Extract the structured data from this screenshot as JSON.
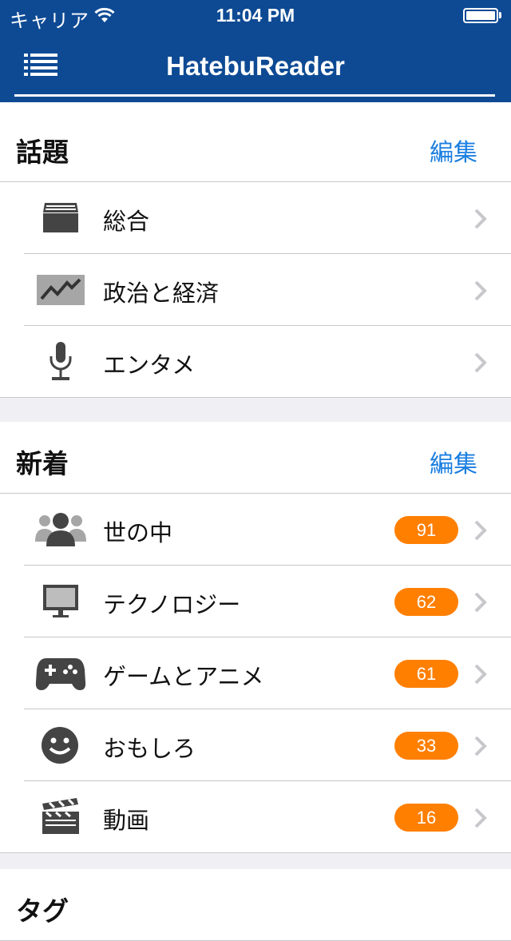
{
  "status_bar": {
    "carrier": "キャリア",
    "time": "11:04 PM"
  },
  "nav": {
    "title": "HatebuReader"
  },
  "sections": {
    "hot": {
      "title": "話題",
      "edit_label": "編集",
      "items": [
        {
          "label": "総合",
          "icon": "inbox-icon"
        },
        {
          "label": "政治と経済",
          "icon": "chart-line-icon"
        },
        {
          "label": "エンタメ",
          "icon": "microphone-icon"
        }
      ]
    },
    "new": {
      "title": "新着",
      "edit_label": "編集",
      "items": [
        {
          "label": "世の中",
          "count": "91",
          "icon": "people-icon"
        },
        {
          "label": "テクノロジー",
          "count": "62",
          "icon": "monitor-icon"
        },
        {
          "label": "ゲームとアニメ",
          "count": "61",
          "icon": "gamepad-icon"
        },
        {
          "label": "おもしろ",
          "count": "33",
          "icon": "smiley-icon"
        },
        {
          "label": "動画",
          "count": "16",
          "icon": "clapperboard-icon"
        }
      ]
    },
    "tags": {
      "title": "タグ"
    }
  },
  "colors": {
    "nav_bg": "#0e4a94",
    "accent": "#1a7ee0",
    "badge": "#ff7f00",
    "icon_gray": "#444444"
  }
}
